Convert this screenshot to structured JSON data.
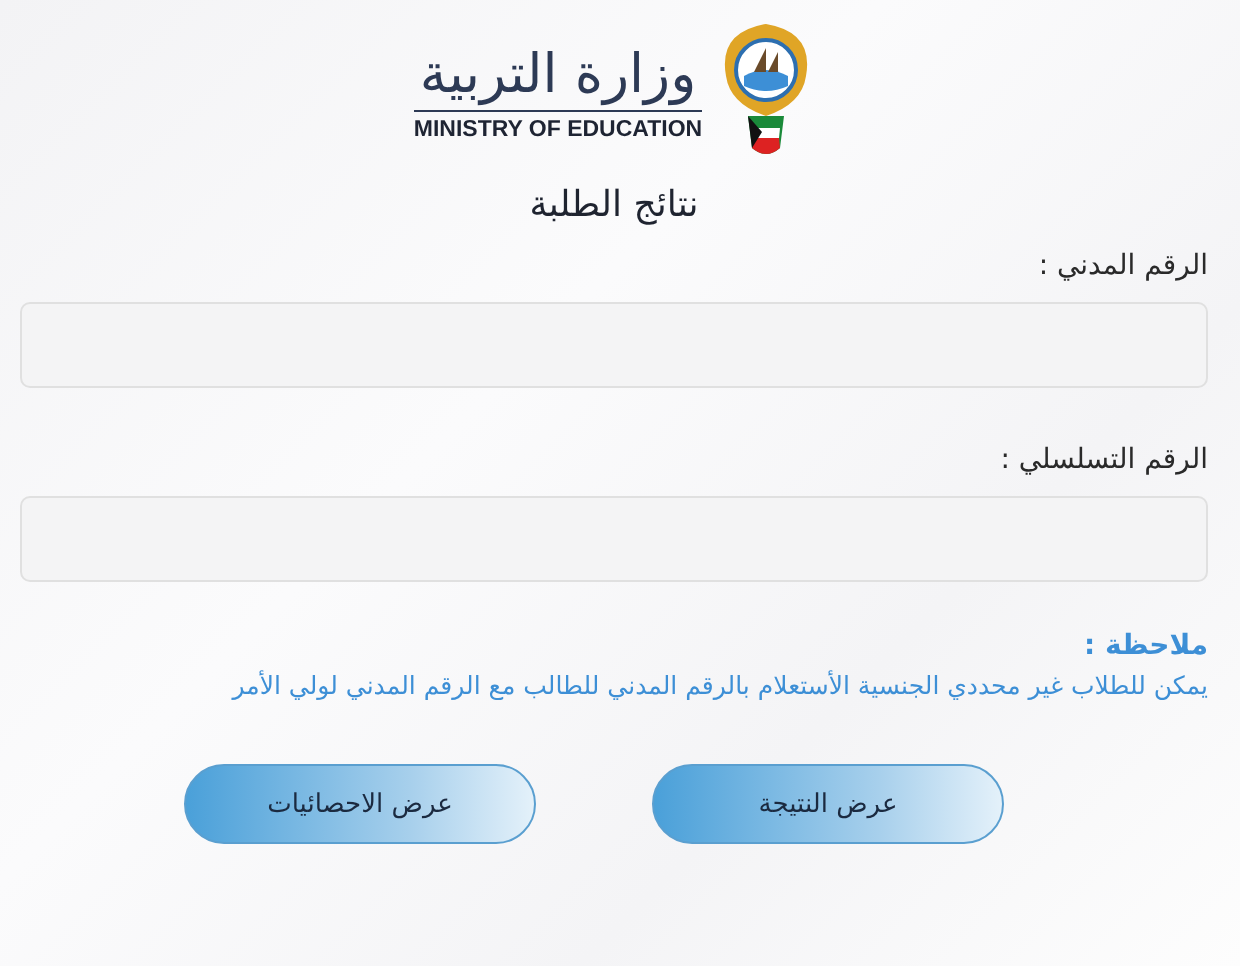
{
  "header": {
    "title_ar": "وزارة التربية",
    "title_en": "MINISTRY OF EDUCATION",
    "subtitle": "نتائج الطلبة"
  },
  "fields": [
    {
      "label": "الرقم المدني :"
    },
    {
      "label": "الرقم التسلسلي :"
    }
  ],
  "note": {
    "title": "ملاحظة :",
    "text": "يمكن للطلاب غير محددي الجنسية الأستعلام بالرقم المدني للطالب مع الرقم المدني لولي الأمر"
  },
  "buttons": [
    "عرض النتيجة",
    "عرض الاحصائيات"
  ]
}
